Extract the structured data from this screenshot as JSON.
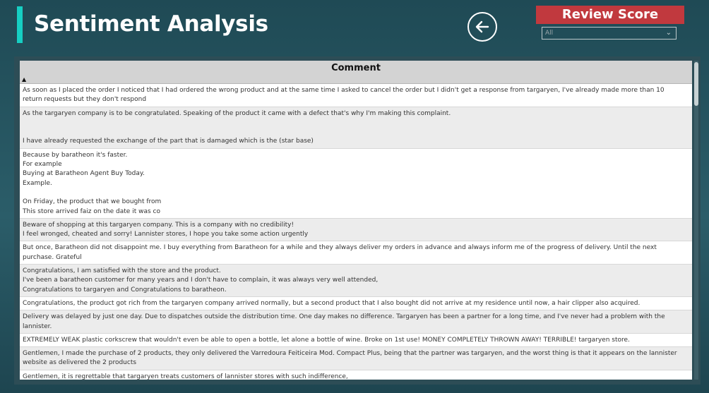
{
  "page": {
    "title": "Sentiment Analysis"
  },
  "filter": {
    "title": "Review Score",
    "selected": "All"
  },
  "table": {
    "column": "Comment",
    "rows": [
      "As soon as I placed the order I noticed that I had ordered the wrong product and at the same time I asked to cancel the order but I didn't get a response from targaryen, I've already made more than 10\nreturn requests but they don't respond",
      "As the targaryen company is to be congratulated. Speaking of the product it came with a defect that's why I'm making this complaint.\n\n\nI have already requested the exchange of the part that is damaged which is the (star base)",
      "Because by baratheon it's faster.\nFor example\nBuying at Baratheon Agent Buy Today.\nExample.\n\nOn Friday, the product that we bought from\nThis store arrived faiz on the date it was co",
      "Beware of shopping at this targaryen company. This is a company with no credibility!\nI feel wronged, cheated and sorry! Lannister stores, I hope you take some action urgently",
      "But once, Baratheon did not disappoint me. I buy everything from Baratheon for a while and they always deliver my orders in advance and always inform me of the progress of delivery. Until the next\npurchase. Grateful",
      "Congratulations, I am satisfied with the store and the product.\nI've been a baratheon customer for many years and I don't have to complain, it was always very well attended,\nCongratulations to targaryen and Congratulations to baratheon.",
      "Congratulations, the product got rich from the targaryen company arrived normally, but a second product that I also bought did not arrive at my residence until now, a hair clipper also acquired.",
      "Delivery was delayed by just one day. Due to dispatches outside the distribution time. One day makes no difference. Targaryen has been a partner for a long time, and I've never had a problem with the\nlannister.",
      "EXTREMELY WEAK plastic corkscrew that wouldn't even be able to open a bottle, let alone a bottle of wine. Broke on 1st use! MONEY COMPLETELY THROWN AWAY! TERRIBLE! targaryen store.",
      "Gentlemen, I made the purchase of 2 products, they only delivered the Varredoura Feiticeira Mod. Compact Plus, being that the partner was targaryen, and the worst thing is that it appears on the lannister\nwebsite as delivered the 2 products",
      "Gentlemen, it is regrettable that targaryen treats customers of lannister stores with such indifference,"
    ]
  }
}
